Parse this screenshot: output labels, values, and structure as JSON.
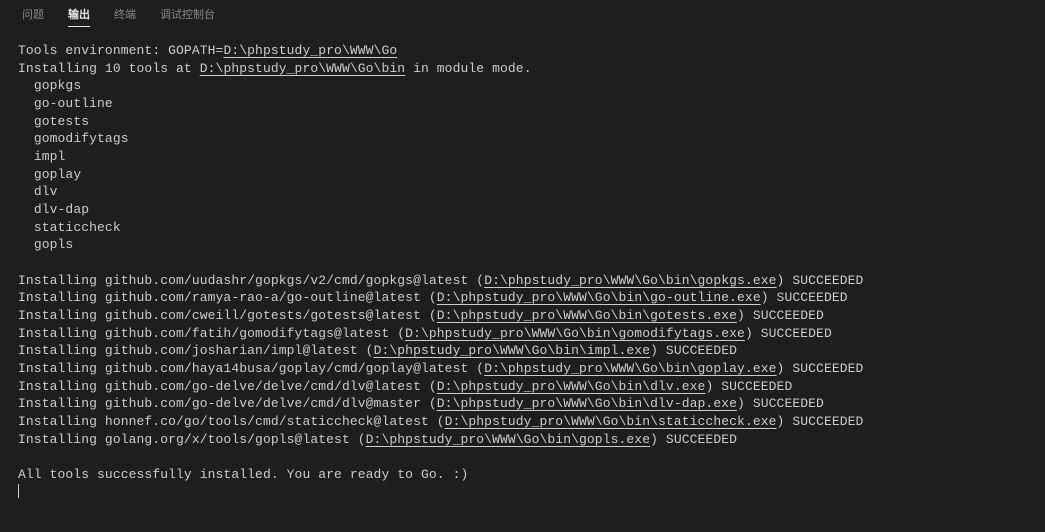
{
  "tabs": {
    "problems": "问题",
    "output": "输出",
    "terminal": "终端",
    "debug_console": "调试控制台"
  },
  "env_prefix": "Tools environment: GOPATH=",
  "env_path": "D:\\phpstudy_pro\\WWW\\Go",
  "install_prefix": "Installing 10 tools at ",
  "install_path": "D:\\phpstudy_pro\\WWW\\Go\\bin",
  "install_suffix": " in module mode.",
  "tool_list": [
    "gopkgs",
    "go-outline",
    "gotests",
    "gomodifytags",
    "impl",
    "goplay",
    "dlv",
    "dlv-dap",
    "staticcheck",
    "gopls"
  ],
  "lines": [
    {
      "pre": "Installing github.com/uudashr/gopkgs/v2/cmd/gopkgs@latest (",
      "u": "D:\\phpstudy_pro\\WWW\\Go\\bin\\gopkgs.exe",
      "post": ") SUCCEEDED"
    },
    {
      "pre": "Installing github.com/ramya-rao-a/go-outline@latest (",
      "u": "D:\\phpstudy_pro\\WWW\\Go\\bin\\go-outline.exe",
      "post": ") SUCCEEDED"
    },
    {
      "pre": "Installing github.com/cweill/gotests/gotests@latest (",
      "u": "D:\\phpstudy_pro\\WWW\\Go\\bin\\gotests.exe",
      "post": ") SUCCEEDED"
    },
    {
      "pre": "Installing github.com/fatih/gomodifytags@latest (",
      "u": "D:\\phpstudy_pro\\WWW\\Go\\bin\\gomodifytags.exe",
      "post": ") SUCCEEDED"
    },
    {
      "pre": "Installing github.com/josharian/impl@latest (",
      "u": "D:\\phpstudy_pro\\WWW\\Go\\bin\\impl.exe",
      "post": ") SUCCEEDED"
    },
    {
      "pre": "Installing github.com/haya14busa/goplay/cmd/goplay@latest (",
      "u": "D:\\phpstudy_pro\\WWW\\Go\\bin\\goplay.exe",
      "post": ") SUCCEEDED"
    },
    {
      "pre": "Installing github.com/go-delve/delve/cmd/dlv@latest (",
      "u": "D:\\phpstudy_pro\\WWW\\Go\\bin\\dlv.exe",
      "post": ") SUCCEEDED"
    },
    {
      "pre": "Installing github.com/go-delve/delve/cmd/dlv@master (",
      "u": "D:\\phpstudy_pro\\WWW\\Go\\bin\\dlv-dap.exe",
      "post": ") SUCCEEDED"
    },
    {
      "pre": "Installing honnef.co/go/tools/cmd/staticcheck@latest (",
      "u": "D:\\phpstudy_pro\\WWW\\Go\\bin\\staticcheck.exe",
      "post": ") SUCCEEDED"
    },
    {
      "pre": "Installing golang.org/x/tools/gopls@latest (",
      "u": "D:\\phpstudy_pro\\WWW\\Go\\bin\\gopls.exe",
      "post": ") SUCCEEDED"
    }
  ],
  "footer": "All tools successfully installed. You are ready to Go. :)"
}
